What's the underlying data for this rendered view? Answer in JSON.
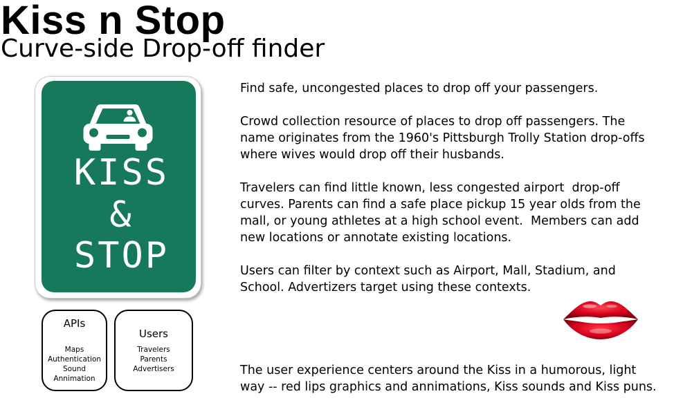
{
  "header": {
    "title": "Kiss n Stop",
    "subtitle": "Curve-side Drop-off finder"
  },
  "sign": {
    "icon": "car-icon",
    "lines": [
      "KISS",
      "&",
      "STOP"
    ]
  },
  "boxes": {
    "apis": {
      "heading": "APIs",
      "items": [
        "Maps",
        "Authentication",
        "Sound",
        "Annimation"
      ]
    },
    "users": {
      "heading": "Users",
      "items": [
        "Travelers",
        "Parents",
        "Advertisers"
      ]
    }
  },
  "description": {
    "paragraphs": [
      {
        "lines": [
          "Find safe, uncongested places to drop off your passengers."
        ]
      },
      {
        "lines": [
          "Crowd collection resource of places to drop off passengers. The",
          "name originates from the 1960's Pittsburgh Trolly Station drop-offs",
          "where wives would drop off their husbands."
        ]
      },
      {
        "lines": [
          "Travelers can find little known, less congested airport  drop-off",
          "curves. Parents can find a safe place pickup 15 year olds from the",
          "mall, or young athletes at a high school event.  Members can add",
          "new locations or annotate existing locations."
        ]
      },
      {
        "lines": [
          "Users can filter by context such as Airport, Mall, Stadium, and",
          "School. Advertizers target using these contexts."
        ]
      },
      {
        "lines": [
          "The user experience centers around the Kiss in a humorous, light",
          "way -- red lips graphics and annimations, Kiss sounds and Kiss puns."
        ]
      }
    ]
  },
  "lips": {
    "icon": "red-lips-icon"
  },
  "colors": {
    "sign_green": "#17795b",
    "sign_foreground": "#ffffff",
    "lips_red": "#d6001c",
    "text": "#000000"
  }
}
